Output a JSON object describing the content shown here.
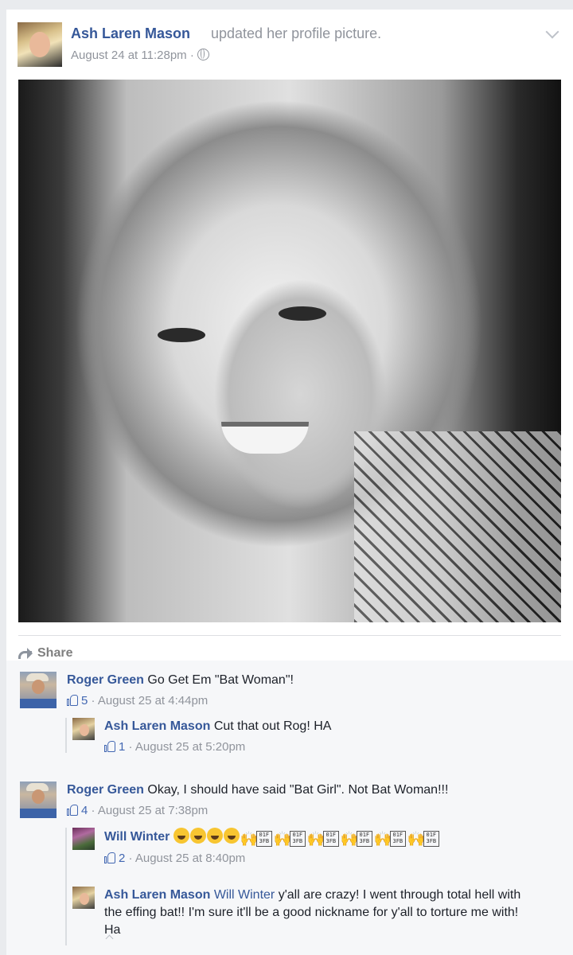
{
  "post": {
    "author": "Ash Laren Mason",
    "action": "updated her profile picture.",
    "timestamp": "August 24 at 11:28pm",
    "privacy_icon": "globe-icon",
    "menu_icon": "chevron-down-icon"
  },
  "actions": {
    "share_label": "Share"
  },
  "comments": [
    {
      "author": "Roger Green",
      "text": "Go Get Em \"Bat Woman\"!",
      "likes": "5",
      "timestamp": "August 25 at 4:44pm",
      "replies": [
        {
          "author": "Ash Laren Mason",
          "text": "Cut that out Rog! HA",
          "likes": "1",
          "timestamp": "August 25 at 5:20pm"
        }
      ]
    },
    {
      "author": "Roger Green",
      "text": "Okay, I should have said \"Bat Girl\". Not Bat Woman!!!",
      "likes": "4",
      "timestamp": "August 25 at 7:38pm",
      "replies": [
        {
          "author": "Will Winter",
          "text": "",
          "likes": "2",
          "timestamp": "August 25 at 8:40pm",
          "emoji_box_text": "01F\n3FB"
        },
        {
          "author": "Ash Laren Mason",
          "mention": "Will Winter",
          "text": "y'all are crazy! I went through total hell with the effing bat!! I'm sure it'll be a good nickname for y'all to torture me with! Ha"
        }
      ]
    }
  ],
  "colors": {
    "link": "#365899",
    "meta": "#90949c",
    "like": "#4267b2",
    "background": "#e9ebee"
  }
}
